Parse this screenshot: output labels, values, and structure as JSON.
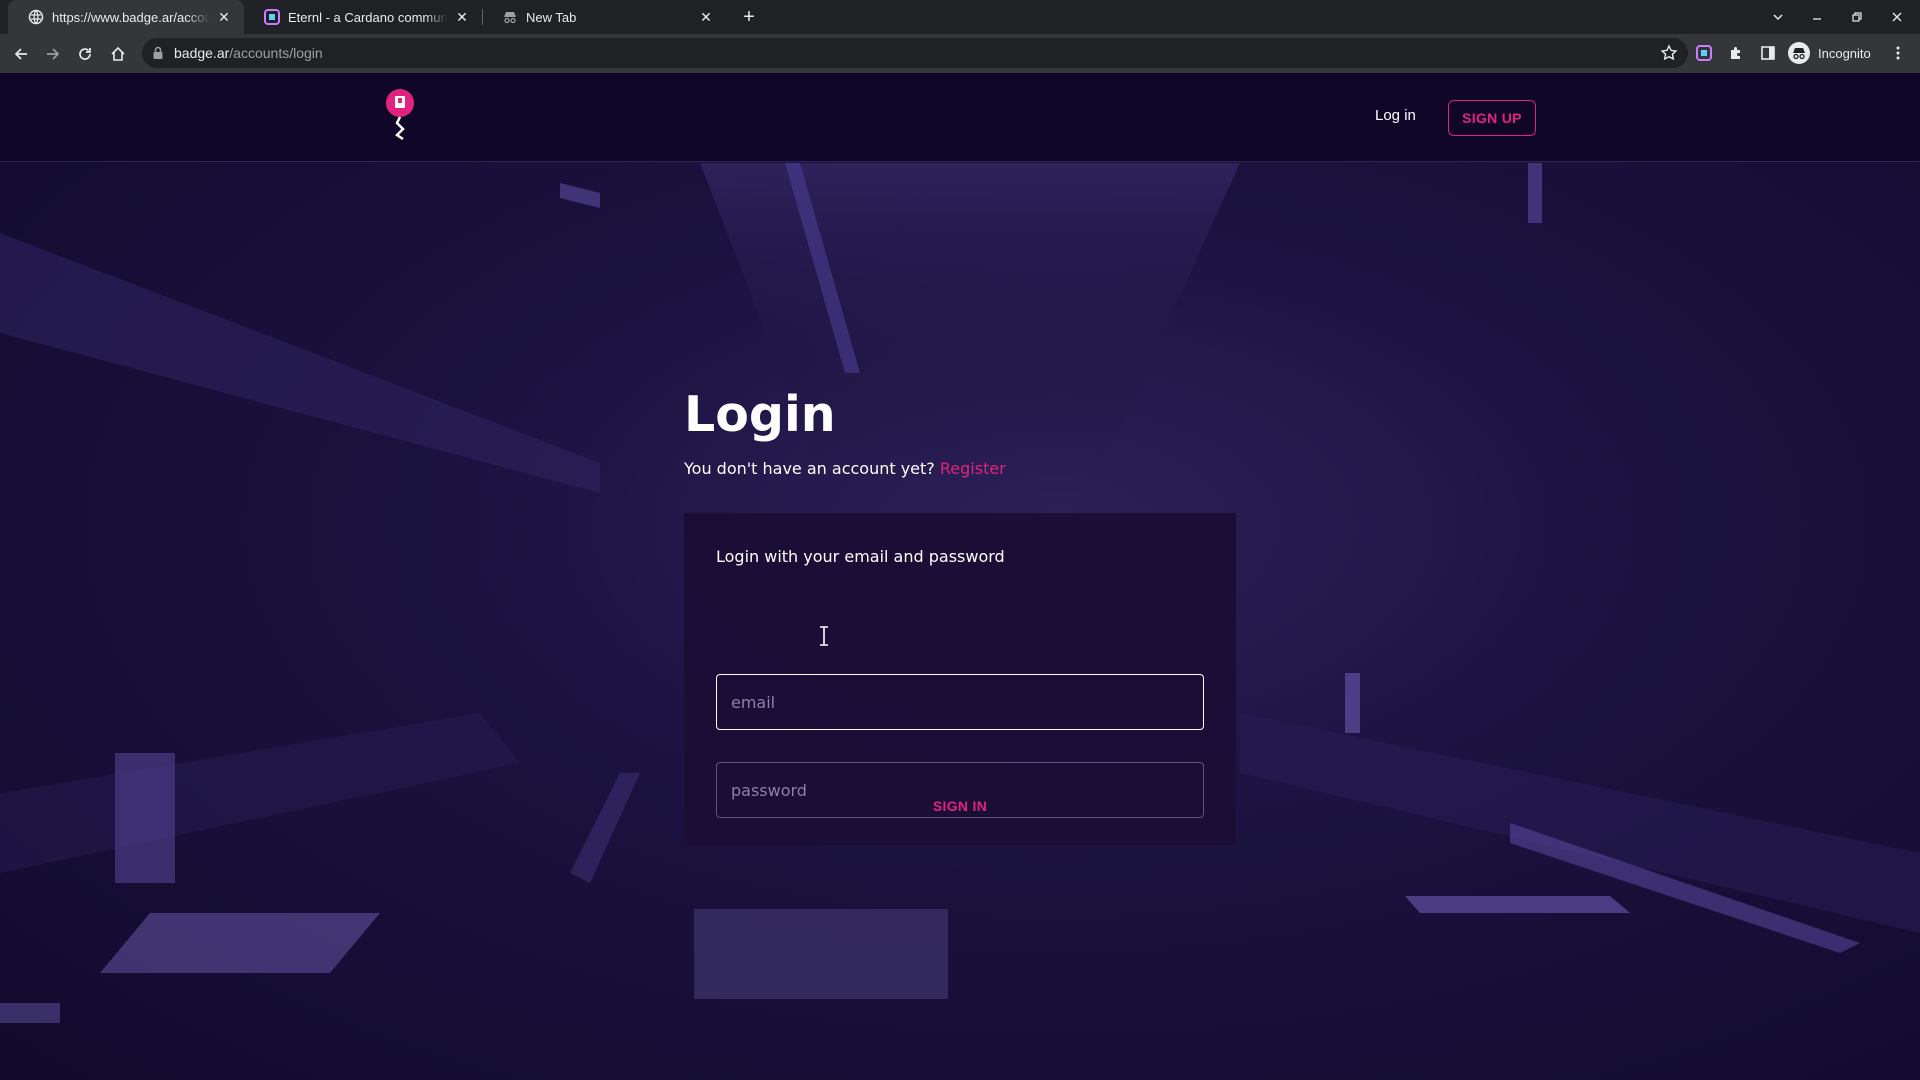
{
  "browser": {
    "tabs": [
      {
        "title": "https://www.badge.ar/accounts/login",
        "active": true
      },
      {
        "title": "Eternl - a Cardano community wallet",
        "active": false
      },
      {
        "title": "New Tab",
        "active": false
      }
    ],
    "url_host": "badge.ar",
    "url_path": "/accounts/login",
    "profile_label": "Incognito"
  },
  "site": {
    "nav": {
      "login_label": "Log in",
      "signup_label": "SIGN UP"
    },
    "login": {
      "title": "Login",
      "no_account_text": "You don't have an account yet?",
      "register_link": "Register",
      "card_heading": "Login with your email and password",
      "email_placeholder": "email",
      "email_value": "",
      "password_placeholder": "password",
      "password_value": "",
      "signin_label": "SIGN IN"
    }
  },
  "colors": {
    "accent": "#e0247d",
    "page_bg": "#1b1240",
    "nav_bg": "#0f0628",
    "card_bg": "#1a0e36"
  },
  "icons": [
    "globe-icon",
    "eternl-icon",
    "incognito-icon",
    "close-icon",
    "plus-icon",
    "chevron-down-icon",
    "minimize-icon",
    "restore-icon",
    "back-icon",
    "forward-icon",
    "reload-icon",
    "home-icon",
    "lock-icon",
    "star-icon",
    "extension-icon",
    "puzzle-icon",
    "sidepanel-icon",
    "menu-icon",
    "badge-logo",
    "text-cursor-icon"
  ]
}
